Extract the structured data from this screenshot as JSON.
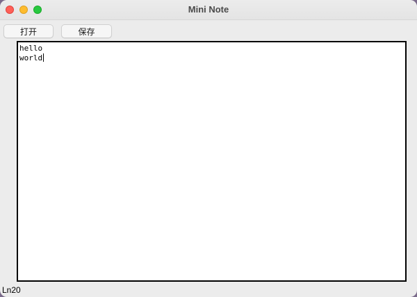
{
  "window": {
    "title": "Mini Note"
  },
  "toolbar": {
    "open_label": "打开",
    "save_label": "保存"
  },
  "editor": {
    "lines": [
      "hello",
      "world"
    ]
  },
  "status": {
    "text": "Ln20"
  },
  "colors": {
    "close": "#ff5f57",
    "minimize": "#febc2e",
    "maximize": "#28c840"
  }
}
